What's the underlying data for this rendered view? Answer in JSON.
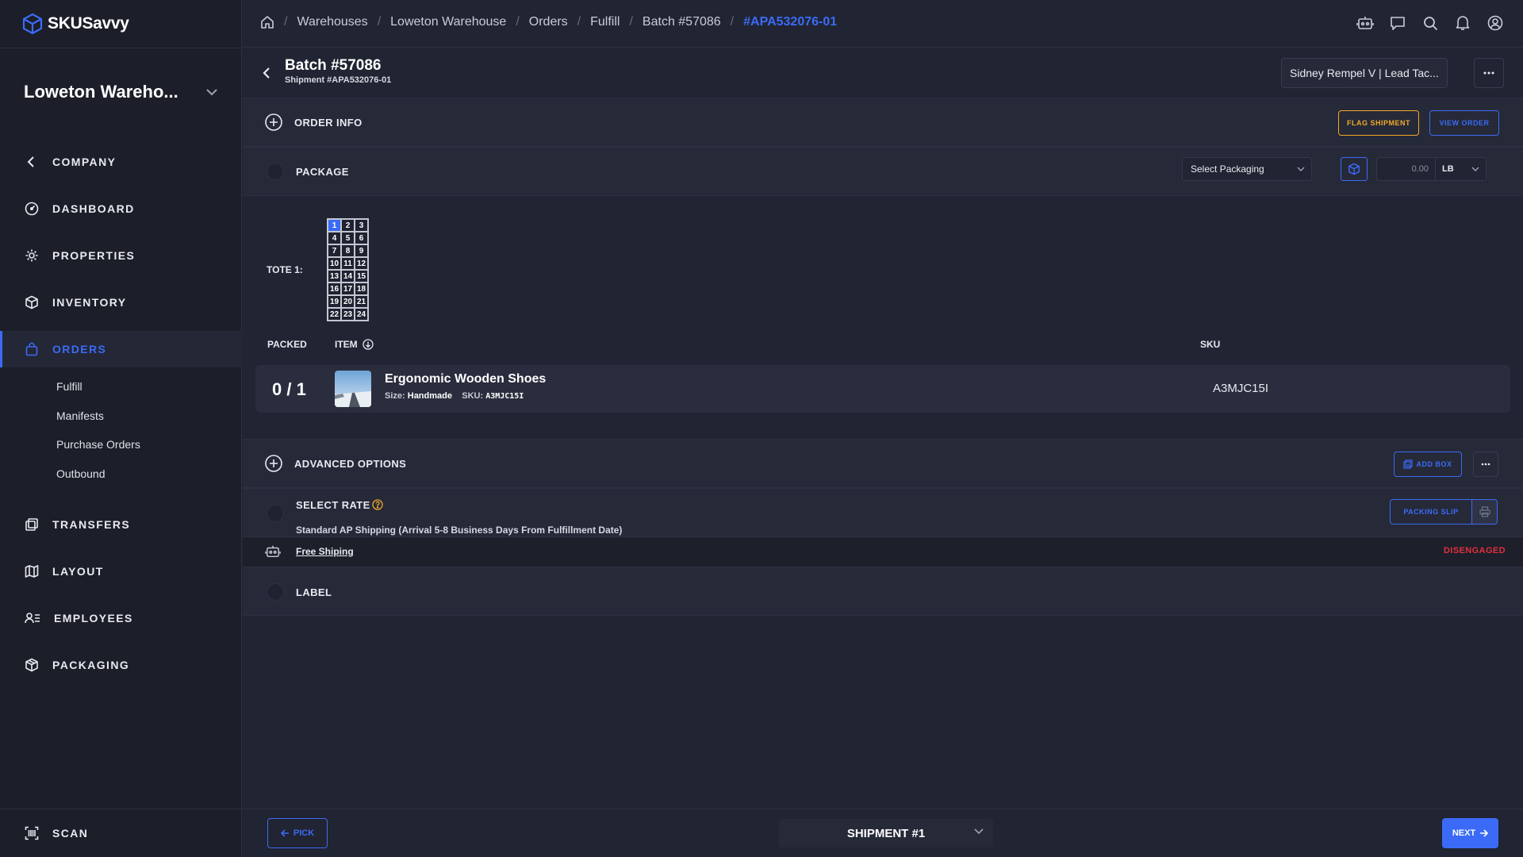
{
  "app": {
    "name": "SKUSavvy",
    "brand_color": "#3b6bf6"
  },
  "sidebar": {
    "warehouse": "Loweton Wareho...",
    "nav": [
      {
        "label": "COMPANY",
        "icon": "chevron-left-icon"
      },
      {
        "label": "DASHBOARD",
        "icon": "gauge-icon"
      },
      {
        "label": "PROPERTIES",
        "icon": "gear-icon"
      },
      {
        "label": "INVENTORY",
        "icon": "box-icon"
      },
      {
        "label": "ORDERS",
        "icon": "bag-icon",
        "active": true
      },
      {
        "label": "TRANSFERS",
        "icon": "transfer-icon"
      },
      {
        "label": "LAYOUT",
        "icon": "map-icon"
      },
      {
        "label": "EMPLOYEES",
        "icon": "employees-icon"
      },
      {
        "label": "PACKAGING",
        "icon": "package-icon"
      }
    ],
    "orders_sub": [
      "Fulfill",
      "Manifests",
      "Purchase Orders",
      "Outbound"
    ],
    "scan_label": "SCAN"
  },
  "breadcrumbs": [
    "Warehouses",
    "Loweton Warehouse",
    "Orders",
    "Fulfill",
    "Batch #57086",
    "#APA532076-01"
  ],
  "header": {
    "title": "Batch #57086",
    "subtitle": "Shipment #APA532076-01",
    "user": "Sidney Rempel V | Lead Tac..."
  },
  "order_info": {
    "title": "ORDER INFO",
    "flag_label": "FLAG SHIPMENT",
    "view_label": "VIEW ORDER"
  },
  "package": {
    "title": "PACKAGE",
    "packaging_placeholder": "Select Packaging",
    "weight": "0.00",
    "unit": "LB"
  },
  "tote": {
    "label": "TOTE 1:",
    "slots": [
      "1",
      "2",
      "3",
      "4",
      "5",
      "6",
      "7",
      "8",
      "9",
      "10",
      "11",
      "12",
      "13",
      "14",
      "15",
      "16",
      "17",
      "18",
      "19",
      "20",
      "21",
      "22",
      "23",
      "24"
    ],
    "selected": "1"
  },
  "items_table": {
    "headers": {
      "packed": "PACKED",
      "item": "ITEM",
      "sku": "SKU"
    },
    "rows": [
      {
        "packed": "0 / 1",
        "name": "Ergonomic Wooden Shoes",
        "size_label": "Size:",
        "size": "Handmade",
        "sku_label": "SKU:",
        "sku_inline": "A3MJC15I",
        "sku": "A3MJC15I"
      }
    ]
  },
  "advanced": {
    "title": "ADVANCED OPTIONS",
    "add_box_label": "ADD BOX"
  },
  "rate": {
    "title": "SELECT RATE",
    "detail": "Standard AP Shipping (Arrival 5-8 Business Days From Fulfillment Date)",
    "packing_slip_label": "PACKING SLIP"
  },
  "rule": {
    "link": "Free Shiping",
    "status": "DISENGAGED",
    "status_color": "#e0303d"
  },
  "label_section": {
    "title": "LABEL"
  },
  "footer": {
    "pick_label": "PICK",
    "shipment": "SHIPMENT #1",
    "next_label": "NEXT"
  }
}
